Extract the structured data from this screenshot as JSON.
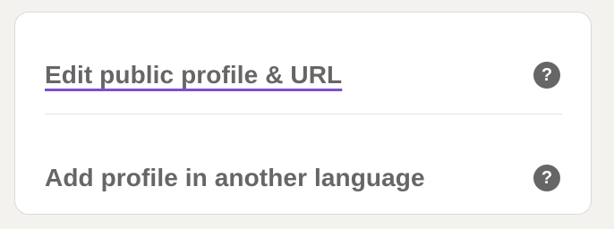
{
  "profile_links": {
    "edit_public_profile_label": "Edit public profile & URL",
    "add_language_profile_label": "Add profile in another language",
    "help_icon_glyph": "?"
  },
  "colors": {
    "accent_underline": "#7a4fd1",
    "text": "#666666",
    "page_background": "#f3f2ef",
    "card_background": "#ffffff"
  },
  "icons": {
    "help": "question-circle-icon"
  }
}
